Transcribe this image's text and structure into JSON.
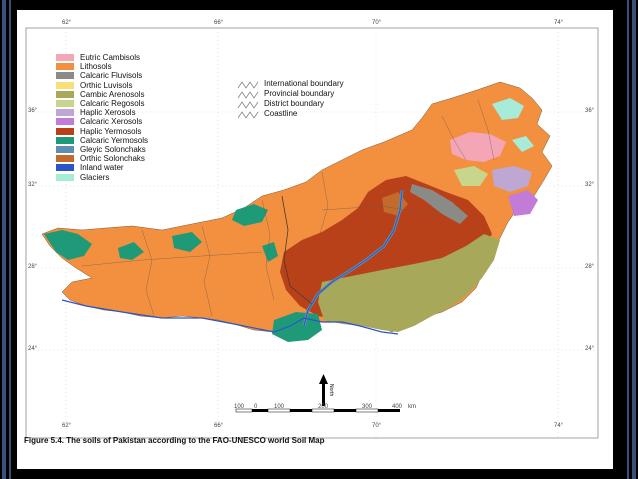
{
  "map": {
    "title": "Figure 5.4. The soils of Pakistan according to the FAO-UNESCO world Soil Map",
    "graticule": {
      "longitudes": [
        "62°",
        "66°",
        "70°",
        "74°"
      ],
      "latitudes": [
        "36°",
        "32°",
        "28°",
        "24°"
      ]
    },
    "legend": [
      {
        "label": "Eutric Cambisols",
        "color": "#f4a6b6"
      },
      {
        "label": "Lithosols",
        "color": "#f29040"
      },
      {
        "label": "Calcaric Fluvisols",
        "color": "#8a8a86"
      },
      {
        "label": "Orthic Luvisols",
        "color": "#f7e07a"
      },
      {
        "label": "Cambic Arenosols",
        "color": "#a7a85a"
      },
      {
        "label": "Calcaric Regosols",
        "color": "#c7d68b"
      },
      {
        "label": "Haplic Xerosols",
        "color": "#bfa7d4"
      },
      {
        "label": "Calcaric Xerosols",
        "color": "#c27bd6"
      },
      {
        "label": "Haplic Yermosols",
        "color": "#b8411a"
      },
      {
        "label": "Calcaric Yermosols",
        "color": "#1f9a78"
      },
      {
        "label": "Gleyic Solonchaks",
        "color": "#5f8fb0"
      },
      {
        "label": "Orthic Solonchaks",
        "color": "#c46a2a"
      },
      {
        "label": "Inland water",
        "color": "#2a55c8"
      },
      {
        "label": "Glaciers",
        "color": "#a6ecd8"
      }
    ],
    "boundaries": [
      "International boundary",
      "Provincial boundary",
      "District boundary",
      "Coastline"
    ],
    "scale": {
      "labels": [
        "100",
        "0",
        "100",
        "200",
        "300",
        "400",
        "km"
      ]
    },
    "north_label": "North"
  }
}
